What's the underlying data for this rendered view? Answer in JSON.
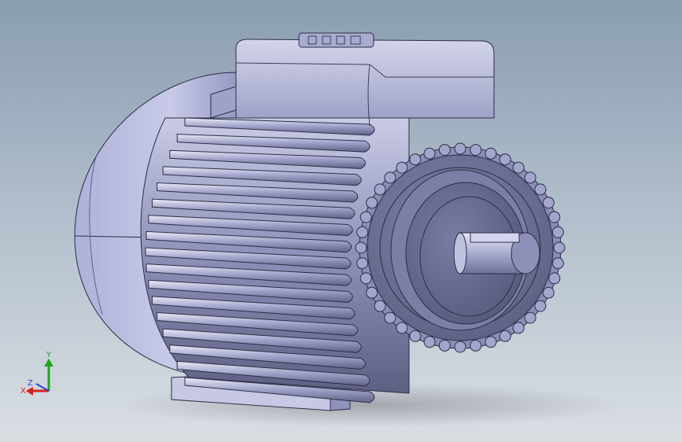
{
  "viewport": {
    "background_top": "#8a9db1",
    "background_bottom": "#d9dee3",
    "model": "electric-motor-3d-model"
  },
  "triad": {
    "x_label": "X",
    "y_label": "Y",
    "z_label": "Z",
    "x_color": "#d31f1f",
    "y_color": "#1fa51f",
    "z_color": "#2a3fd1"
  }
}
